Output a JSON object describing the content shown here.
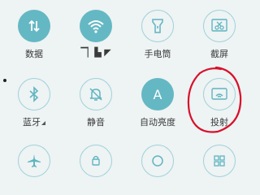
{
  "quick_settings": {
    "row1": [
      {
        "label": "数据",
        "icon": "mobile-data-icon",
        "state": "on"
      },
      {
        "label": "▔▏▙ ◤",
        "icon": "wifi-icon",
        "state": "on"
      },
      {
        "label": "手电筒",
        "icon": "flashlight-icon",
        "state": "off"
      },
      {
        "label": "截屏",
        "icon": "screenshot-scissors-icon",
        "state": "off"
      }
    ],
    "row2": [
      {
        "label": "蓝牙",
        "icon": "bluetooth-icon",
        "state": "off"
      },
      {
        "label": "静音",
        "icon": "mute-bell-icon",
        "state": "off"
      },
      {
        "label": "自动亮度",
        "icon": "auto-brightness-icon",
        "state": "on",
        "glyph": "A"
      },
      {
        "label": "投射",
        "icon": "screen-cast-icon",
        "state": "off"
      }
    ],
    "row3": [
      {
        "icon": "airplane-icon",
        "state": "off"
      },
      {
        "icon": "lock-rotation-icon",
        "state": "off"
      },
      {
        "icon": "location-icon",
        "state": "off"
      },
      {
        "icon": "apps-grid-icon",
        "state": "off"
      }
    ]
  },
  "colors": {
    "accent": "#64b8c3",
    "outline": "#9fd2d9",
    "background": "#eef3f4",
    "annotation": "#d8102a"
  }
}
